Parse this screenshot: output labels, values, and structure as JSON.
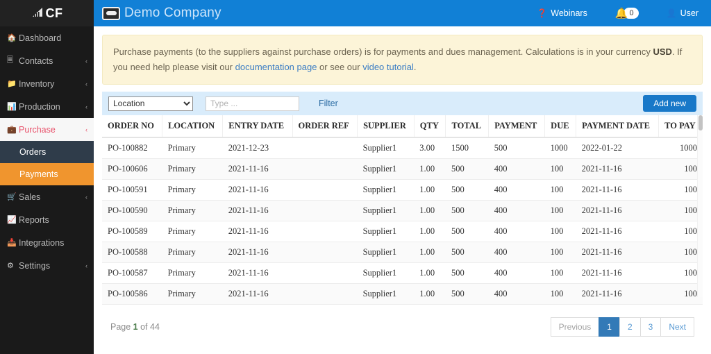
{
  "sidebar": {
    "brand": "CF",
    "brand_icon": "chart-bars-icon",
    "items": [
      {
        "label": "Dashboard",
        "icon": "home-icon",
        "caret": ""
      },
      {
        "label": "Contacts",
        "icon": "id-card-icon",
        "caret": "‹"
      },
      {
        "label": "Inventory",
        "icon": "folder-icon",
        "caret": "‹"
      },
      {
        "label": "Production",
        "icon": "factory-icon",
        "caret": "‹"
      },
      {
        "label": "Purchase",
        "icon": "briefcase-icon",
        "caret": "‹"
      },
      {
        "label": "Sales",
        "icon": "cart-icon",
        "caret": "‹"
      },
      {
        "label": "Reports",
        "icon": "line-chart-icon",
        "caret": ""
      },
      {
        "label": "Integrations",
        "icon": "signal-bars-icon",
        "caret": ""
      },
      {
        "label": "Settings",
        "icon": "gear-icon",
        "caret": "‹"
      }
    ],
    "submenu": [
      {
        "label": "Orders",
        "active": false
      },
      {
        "label": "Payments",
        "active": true
      }
    ]
  },
  "topbar": {
    "company": "Demo Company",
    "webinars": "Webinars",
    "notification_count": "0",
    "user": "User"
  },
  "alert": {
    "line1_a": "Purchase payments (to the suppliers against purchase orders) is for payments and dues management. Calculations is in your currency ",
    "currency": "USD",
    "line1_b": ". If you need help please visit our ",
    "link_docs": "documentation page",
    "mid": " or see our ",
    "link_video": "video tutorial",
    "end": "."
  },
  "filterbar": {
    "location_select": "Location",
    "search_placeholder": "Type ...",
    "filter_button": "Filter",
    "add_new_button": "Add new"
  },
  "table": {
    "columns": [
      "ORDER NO",
      "LOCATION",
      "ENTRY DATE",
      "ORDER REF",
      "SUPPLIER",
      "QTY",
      "TOTAL",
      "PAYMENT",
      "DUE",
      "PAYMENT DATE",
      "TO PAY"
    ],
    "rows": [
      {
        "order_no": "PO-100882",
        "location": "Primary",
        "entry_date": "2021-12-23",
        "order_ref": "",
        "supplier": "Supplier1",
        "qty": "3.00",
        "total": "1500",
        "payment": "500",
        "due": "1000",
        "payment_date": "2022-01-22",
        "payment_date_state": "green",
        "to_pay": "1000"
      },
      {
        "order_no": "PO-100606",
        "location": "Primary",
        "entry_date": "2021-11-16",
        "order_ref": "",
        "supplier": "Supplier1",
        "qty": "1.00",
        "total": "500",
        "payment": "400",
        "due": "100",
        "payment_date": "2021-11-16",
        "payment_date_state": "red",
        "to_pay": "100"
      },
      {
        "order_no": "PO-100591",
        "location": "Primary",
        "entry_date": "2021-11-16",
        "order_ref": "",
        "supplier": "Supplier1",
        "qty": "1.00",
        "total": "500",
        "payment": "400",
        "due": "100",
        "payment_date": "2021-11-16",
        "payment_date_state": "red",
        "to_pay": "100"
      },
      {
        "order_no": "PO-100590",
        "location": "Primary",
        "entry_date": "2021-11-16",
        "order_ref": "",
        "supplier": "Supplier1",
        "qty": "1.00",
        "total": "500",
        "payment": "400",
        "due": "100",
        "payment_date": "2021-11-16",
        "payment_date_state": "red",
        "to_pay": "100"
      },
      {
        "order_no": "PO-100589",
        "location": "Primary",
        "entry_date": "2021-11-16",
        "order_ref": "",
        "supplier": "Supplier1",
        "qty": "1.00",
        "total": "500",
        "payment": "400",
        "due": "100",
        "payment_date": "2021-11-16",
        "payment_date_state": "red",
        "to_pay": "100"
      },
      {
        "order_no": "PO-100588",
        "location": "Primary",
        "entry_date": "2021-11-16",
        "order_ref": "",
        "supplier": "Supplier1",
        "qty": "1.00",
        "total": "500",
        "payment": "400",
        "due": "100",
        "payment_date": "2021-11-16",
        "payment_date_state": "red",
        "to_pay": "100"
      },
      {
        "order_no": "PO-100587",
        "location": "Primary",
        "entry_date": "2021-11-16",
        "order_ref": "",
        "supplier": "Supplier1",
        "qty": "1.00",
        "total": "500",
        "payment": "400",
        "due": "100",
        "payment_date": "2021-11-16",
        "payment_date_state": "red",
        "to_pay": "100"
      },
      {
        "order_no": "PO-100586",
        "location": "Primary",
        "entry_date": "2021-11-16",
        "order_ref": "",
        "supplier": "Supplier1",
        "qty": "1.00",
        "total": "500",
        "payment": "400",
        "due": "100",
        "payment_date": "2021-11-16",
        "payment_date_state": "red",
        "to_pay": "100"
      }
    ]
  },
  "footer": {
    "page_prefix": "Page ",
    "page_current": "1",
    "page_suffix": " of 44",
    "pager": [
      {
        "label": "Previous",
        "state": "disabled"
      },
      {
        "label": "1",
        "state": "active"
      },
      {
        "label": "2",
        "state": ""
      },
      {
        "label": "3",
        "state": ""
      },
      {
        "label": "Next",
        "state": ""
      }
    ]
  },
  "colors": {
    "topbar_blue": "#1180d6",
    "sidebar_dark": "#1a1a1a",
    "active_orange": "#f0952e",
    "submenu_slate": "#2f3c4a",
    "purchase_pink": "#e8536c",
    "alert_bg": "#fcf4d8",
    "filter_bg": "#d9ecfb",
    "link_blue": "#5a9bd4",
    "pager_active": "#337ab7",
    "date_green": "#4f9b58",
    "date_red": "#cf4a5e"
  }
}
